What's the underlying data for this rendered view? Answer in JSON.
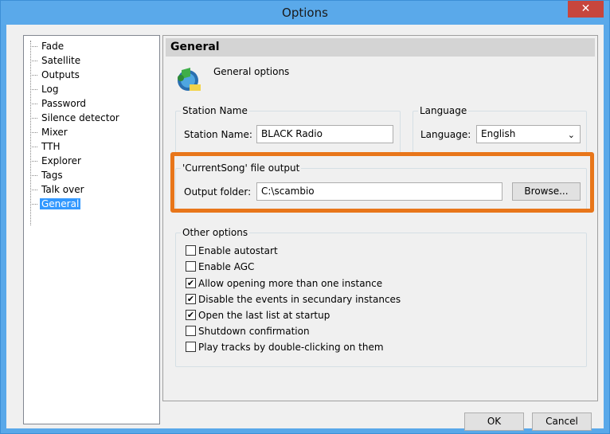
{
  "window": {
    "title": "Options",
    "close_label": "✕"
  },
  "tree": {
    "items": [
      {
        "label": "Fade"
      },
      {
        "label": "Satellite"
      },
      {
        "label": "Outputs"
      },
      {
        "label": "Log"
      },
      {
        "label": "Password"
      },
      {
        "label": "Silence detector"
      },
      {
        "label": "Mixer"
      },
      {
        "label": "TTH"
      },
      {
        "label": "Explorer"
      },
      {
        "label": "Tags"
      },
      {
        "label": "Talk over"
      },
      {
        "label": "General"
      }
    ],
    "selected": "General"
  },
  "panel": {
    "header": "General",
    "subtitle": "General options",
    "station": {
      "group_label": "Station Name",
      "field_label": "Station Name:",
      "value": "BLACK Radio"
    },
    "language": {
      "group_label": "Language",
      "field_label": "Language:",
      "value": "English"
    },
    "current_song": {
      "group_label": "'CurrentSong' file output",
      "field_label": "Output folder:",
      "value": "C:\\scambio",
      "browse_label": "Browse..."
    },
    "other": {
      "group_label": "Other options",
      "options": [
        {
          "label": "Enable autostart",
          "checked": false
        },
        {
          "label": "Enable AGC",
          "checked": false
        },
        {
          "label": "Allow opening more than one instance",
          "checked": true
        },
        {
          "label": "Disable the events in secundary instances",
          "checked": true
        },
        {
          "label": "Open the last list at startup",
          "checked": true
        },
        {
          "label": "Shutdown confirmation",
          "checked": false
        },
        {
          "label": "Play tracks by double-clicking on them",
          "checked": false
        }
      ]
    }
  },
  "buttons": {
    "ok": "OK",
    "cancel": "Cancel"
  },
  "colors": {
    "titlebar": "#5aa9ea",
    "close": "#c7463d",
    "highlight": "#e8761a",
    "selection": "#3399ff"
  },
  "icons": {
    "logo": "radio-logo-icon",
    "check": "✔",
    "dropdown": "chevron-down-icon"
  }
}
